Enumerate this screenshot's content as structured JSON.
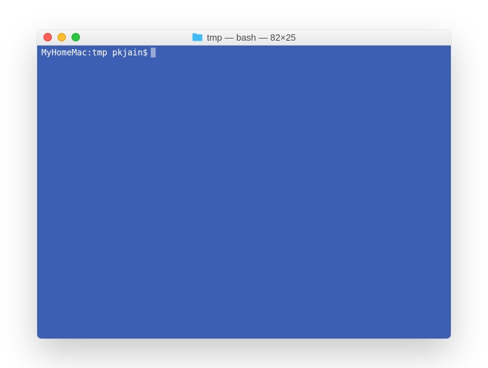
{
  "window": {
    "title": "tmp — bash — 82×25",
    "folder_icon_color": "#3fbcf6"
  },
  "terminal": {
    "background": "#3c5fb3",
    "prompt": "MyHomeMac:tmp pkjain$",
    "input": ""
  }
}
